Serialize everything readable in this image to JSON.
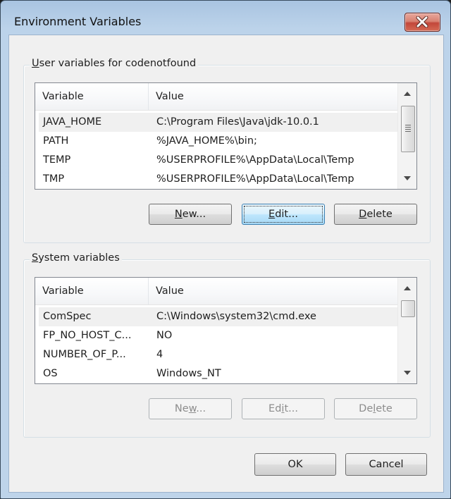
{
  "window": {
    "title": "Environment Variables",
    "close_icon": "close-x-icon"
  },
  "user_group": {
    "label_prefix": "",
    "label_mnemonic": "U",
    "label_rest": "ser variables for codenotfound",
    "columns": [
      "Variable",
      "Value"
    ],
    "rows": [
      {
        "variable": "JAVA_HOME",
        "value": "C:\\Program Files\\Java\\jdk-10.0.1",
        "selected": true
      },
      {
        "variable": "PATH",
        "value": "%JAVA_HOME%\\bin;",
        "selected": false
      },
      {
        "variable": "TEMP",
        "value": "%USERPROFILE%\\AppData\\Local\\Temp",
        "selected": false
      },
      {
        "variable": "TMP",
        "value": "%USERPROFILE%\\AppData\\Local\\Temp",
        "selected": false
      }
    ],
    "buttons": {
      "new": {
        "mnemonic": "N",
        "rest": "ew...",
        "enabled": true
      },
      "edit": {
        "mnemonic": "E",
        "rest": "dit...",
        "enabled": true,
        "focused": true
      },
      "delete": {
        "mnemonic": "D",
        "rest": "elete",
        "enabled": true
      }
    }
  },
  "system_group": {
    "label_mnemonic": "S",
    "label_rest": "ystem variables",
    "columns": [
      "Variable",
      "Value"
    ],
    "rows": [
      {
        "variable": "ComSpec",
        "value": "C:\\Windows\\system32\\cmd.exe",
        "selected": true
      },
      {
        "variable": "FP_NO_HOST_C...",
        "value": "NO",
        "selected": false
      },
      {
        "variable": "NUMBER_OF_P...",
        "value": "4",
        "selected": false
      },
      {
        "variable": "OS",
        "value": "Windows_NT",
        "selected": false
      }
    ],
    "buttons": {
      "new": {
        "pre": "Ne",
        "mnemonic": "w",
        "rest": "...",
        "enabled": false
      },
      "edit": {
        "pre": "Ed",
        "mnemonic": "i",
        "rest": "t...",
        "enabled": false
      },
      "delete": {
        "pre": "De",
        "mnemonic": "l",
        "rest": "ete",
        "enabled": false
      }
    }
  },
  "footer": {
    "ok_label": "OK",
    "cancel_label": "Cancel"
  }
}
